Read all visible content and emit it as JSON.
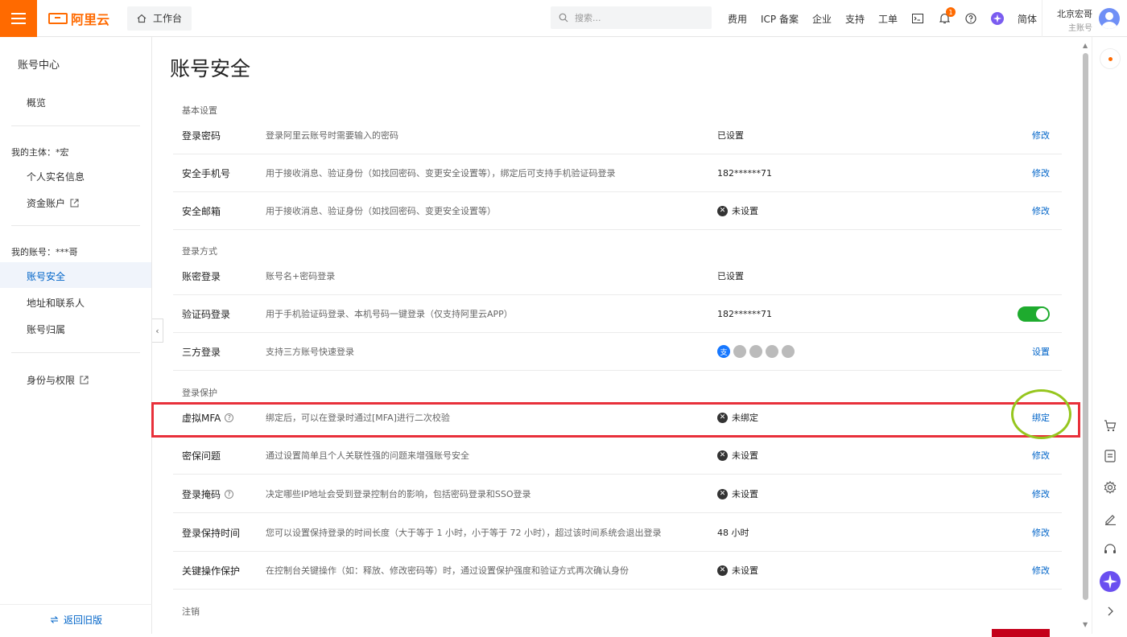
{
  "topbar": {
    "logo_text": "阿里云",
    "workbench": "工作台",
    "search_placeholder": "搜索...",
    "links": [
      "费用",
      "ICP 备案",
      "企业",
      "支持",
      "工单"
    ],
    "notification_count": "1",
    "language": "简体",
    "user_name": "北京宏哥",
    "user_role": "主账号"
  },
  "sidebar": {
    "title": "账号中心",
    "overview": "概览",
    "group_subject": "我的主体：*宏",
    "realname": "个人实名信息",
    "funds": "资金账户",
    "group_account": "我的账号：***哥",
    "security": "账号安全",
    "address": "地址和联系人",
    "ownership": "账号归属",
    "identity": "身份与权限",
    "back_old": "返回旧版"
  },
  "page": {
    "title": "账号安全",
    "sections": {
      "basic": "基本设置",
      "login": "登录方式",
      "protection": "登录保护",
      "cancel": "注销"
    },
    "basic_rows": [
      {
        "name": "登录密码",
        "desc": "登录阿里云账号时需要输入的密码",
        "status": "已设置",
        "action": "修改"
      },
      {
        "name": "安全手机号",
        "desc": "用于接收消息、验证身份（如找回密码、变更安全设置等），绑定后可支持手机验证码登录",
        "status": "182******71",
        "action": "修改"
      },
      {
        "name": "安全邮箱",
        "desc": "用于接收消息、验证身份（如找回密码、变更安全设置等）",
        "status": "未设置",
        "action": "修改"
      }
    ],
    "login_rows": [
      {
        "name": "账密登录",
        "desc": "账号名+密码登录",
        "status": "已设置"
      },
      {
        "name": "验证码登录",
        "desc": "用于手机验证码登录、本机号码一键登录（仅支持阿里云APP）",
        "status": "182******71"
      },
      {
        "name": "三方登录",
        "desc": "支持三方账号快速登录",
        "action": "设置"
      }
    ],
    "protection_rows": [
      {
        "name": "虚拟MFA",
        "desc": "绑定后，可以在登录时通过[MFA]进行二次校验",
        "status": "未绑定",
        "action": "绑定"
      },
      {
        "name": "密保问题",
        "desc": "通过设置简单且个人关联性强的问题来增强账号安全",
        "status": "未设置",
        "action": "修改"
      },
      {
        "name": "登录掩码",
        "desc": "决定哪些IP地址会受到登录控制台的影响，包括密码登录和SSO登录",
        "status": "未设置",
        "action": "修改"
      },
      {
        "name": "登录保持时间",
        "desc": "您可以设置保持登录的时间长度（大于等于 1 小时，小于等于 72 小时），超过该时间系统会退出登录",
        "status": "48 小时",
        "action": "修改"
      },
      {
        "name": "关键操作保护",
        "desc": "在控制台关键操作（如：释放、修改密码等）时，通过设置保护强度和验证方式再次确认身份",
        "status": "未设置",
        "action": "修改"
      }
    ],
    "alipay_glyph": "支"
  },
  "colors": {
    "brand": "#ff6a00",
    "link": "#0064c8",
    "toggle_on": "#1eab2e",
    "highlight_red": "#e8303a",
    "highlight_green": "#96c61e"
  },
  "verification_login_enabled": true
}
